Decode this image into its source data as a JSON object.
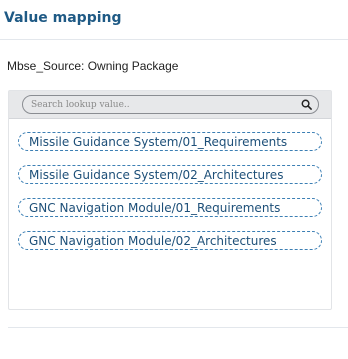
{
  "panel": {
    "title": "Value mapping"
  },
  "field": {
    "label": "Mbse_Source: Owning Package"
  },
  "search": {
    "placeholder": "Search lookup value..",
    "icon": "search-icon"
  },
  "options": [
    {
      "label": "Missile Guidance System/01_Requirements"
    },
    {
      "label": "Missile Guidance System/02_Architectures"
    },
    {
      "label": "GNC Navigation Module/01_Requirements"
    },
    {
      "label": "GNC Navigation Module/02_Architectures"
    }
  ],
  "colors": {
    "title": "#1f5a85",
    "chip_border": "#3c7fb4",
    "chip_text": "#1d4f78",
    "search_bg": "#e7e8ea"
  }
}
